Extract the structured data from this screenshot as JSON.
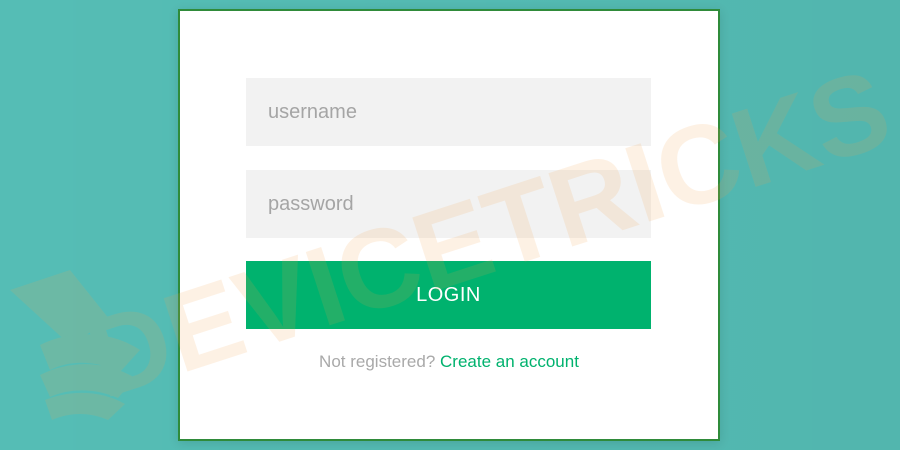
{
  "login_form": {
    "username_placeholder": "username",
    "password_placeholder": "password",
    "login_label": "LOGIN",
    "not_registered_text": "Not registered?",
    "create_account_label": "Create an account"
  },
  "watermark": {
    "text": "DEVICETRICKS",
    "color": "#f6a24a"
  },
  "colors": {
    "background": "#55bdb5",
    "card_border": "#2f8b3a",
    "accent_green": "#00b26e",
    "field_bg": "#f2f2f2"
  }
}
